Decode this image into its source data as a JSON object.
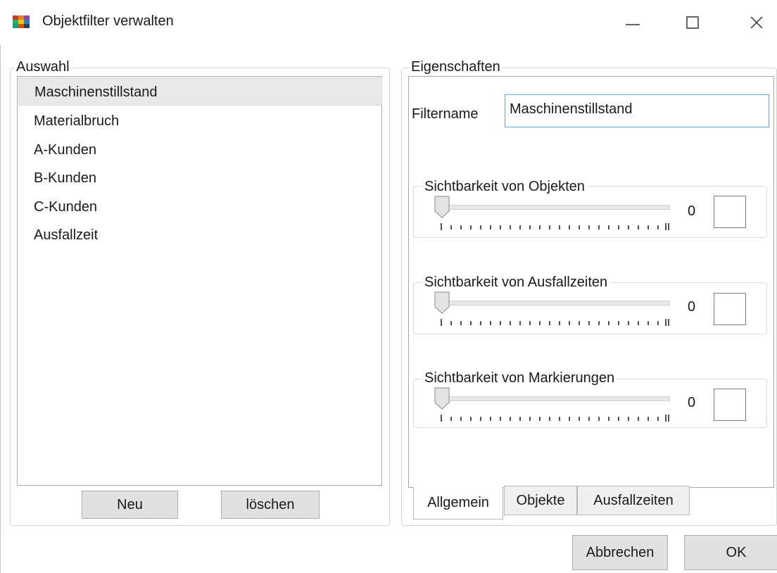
{
  "window": {
    "title": "Objektfilter verwalten",
    "minimize_glyph": "—",
    "maximize_glyph": "☐",
    "close_glyph": "✕"
  },
  "auswahl": {
    "legend": "Auswahl",
    "items": [
      {
        "label": "Maschinenstillstand",
        "selected": true
      },
      {
        "label": "Materialbruch",
        "selected": false
      },
      {
        "label": "A-Kunden",
        "selected": false
      },
      {
        "label": "B-Kunden",
        "selected": false
      },
      {
        "label": "C-Kunden",
        "selected": false
      },
      {
        "label": "Ausfallzeit",
        "selected": false
      }
    ],
    "new_label": "Neu",
    "delete_label": "löschen"
  },
  "eigenschaften": {
    "legend": "Eigenschaften",
    "filtername_label": "Filtername",
    "filtername_value": "Maschinenstillstand",
    "sliders": [
      {
        "label": "Sichtbarkeit von Objekten",
        "value": "0",
        "level": 0,
        "checked": false
      },
      {
        "label": "Sichtbarkeit von Ausfallzeiten",
        "value": "0",
        "level": 0,
        "checked": false
      },
      {
        "label": "Sichtbarkeit von Markierungen",
        "value": "0",
        "level": 0,
        "checked": false
      }
    ],
    "tabs": [
      {
        "label": "Allgemein",
        "active": true
      },
      {
        "label": "Objekte",
        "active": false
      },
      {
        "label": "Ausfallzeiten",
        "active": false
      }
    ]
  },
  "footer": {
    "cancel_label": "Abbrechen",
    "ok_label": "OK"
  }
}
